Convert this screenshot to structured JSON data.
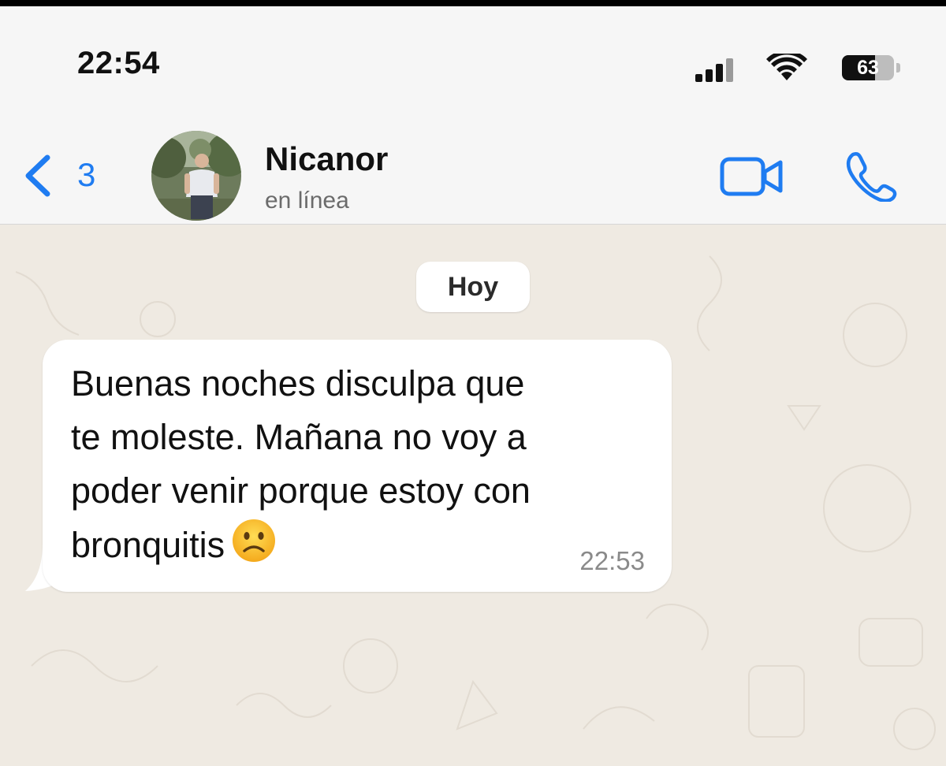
{
  "status_bar": {
    "time": "22:54",
    "battery_level": "63",
    "battery_fraction": 0.63
  },
  "header": {
    "back_count": "3",
    "contact_name": "Nicanor",
    "contact_status": "en línea",
    "icons": [
      "chevron-left-icon",
      "video-camera-icon",
      "phone-icon"
    ],
    "accent_color": "#1f7cf1"
  },
  "chat": {
    "date_chip": "Hoy",
    "messages": [
      {
        "lines": [
          "Buenas noches disculpa que",
          "te moleste. Mañana no voy a",
          "poder venir porque estoy con",
          "bronquitis"
        ],
        "emoji": "slightly-frowning-face-icon",
        "time": "22:53"
      }
    ]
  },
  "colors": {
    "header_background": "#f6f6f6",
    "chat_background": "#efeae2",
    "bubble_background": "#ffffff"
  }
}
